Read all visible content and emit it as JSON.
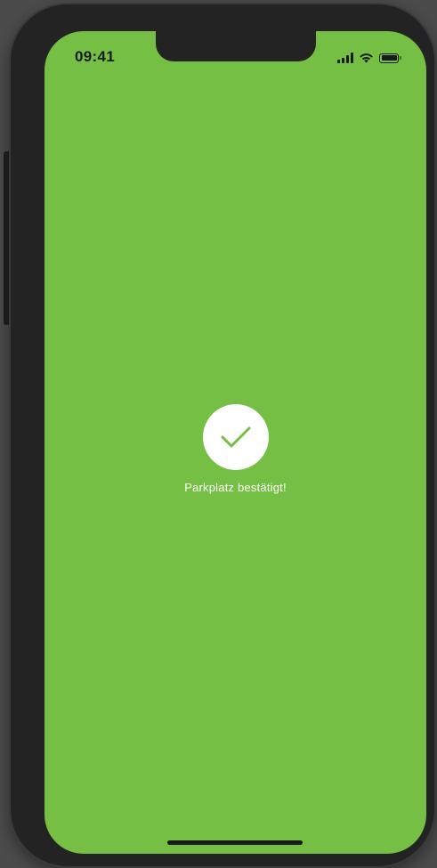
{
  "status_bar": {
    "time": "09:41",
    "icons": [
      "cellular-signal-icon",
      "wifi-icon",
      "battery-icon"
    ]
  },
  "confirmation": {
    "icon": "checkmark-icon",
    "message": "Parkplatz bestätigt!"
  },
  "colors": {
    "screen_background": "#74bf44",
    "check_circle": "#ffffff",
    "check_mark": "#74bf44",
    "message_text": "#ffffff",
    "device_frame": "#232323"
  }
}
